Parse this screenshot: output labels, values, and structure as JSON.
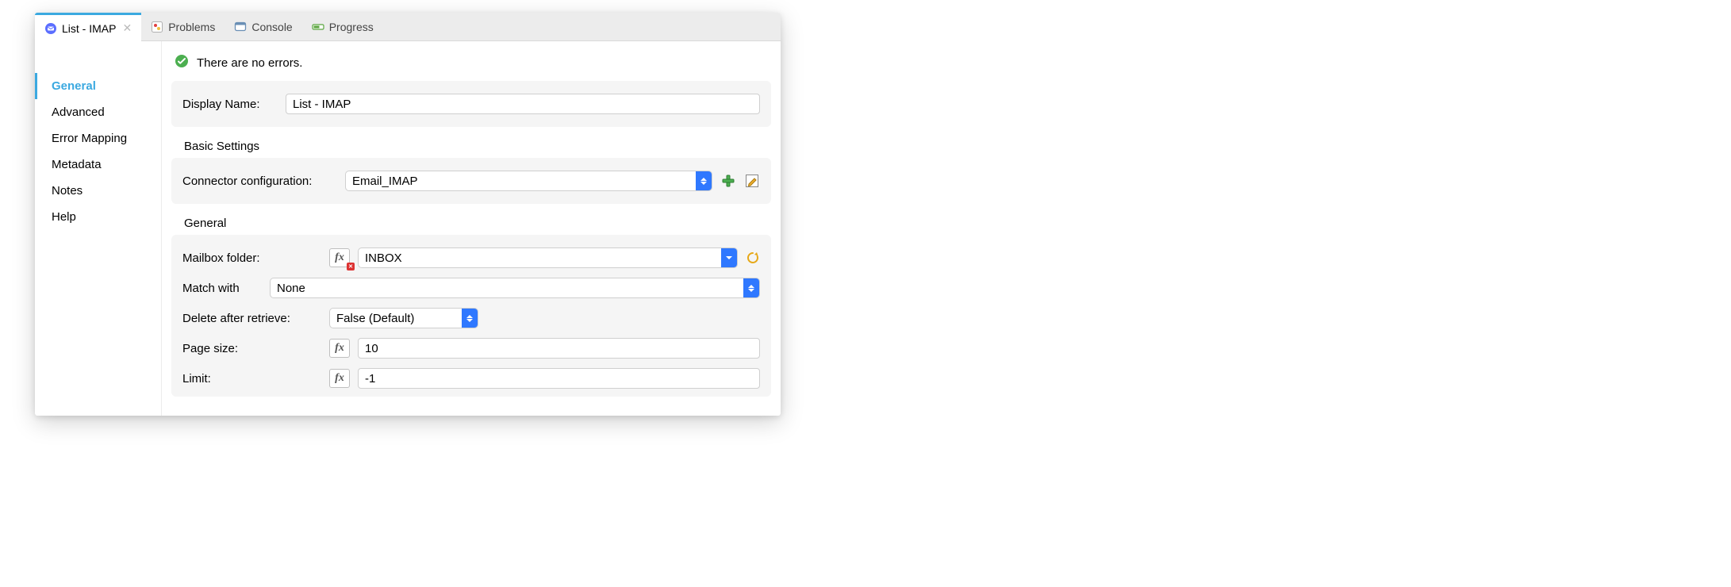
{
  "tabs": [
    {
      "label": "List - IMAP",
      "active": true
    },
    {
      "label": "Problems"
    },
    {
      "label": "Console"
    },
    {
      "label": "Progress"
    }
  ],
  "sidebar": {
    "items": [
      {
        "label": "General",
        "active": true
      },
      {
        "label": "Advanced"
      },
      {
        "label": "Error Mapping"
      },
      {
        "label": "Metadata"
      },
      {
        "label": "Notes"
      },
      {
        "label": "Help"
      }
    ]
  },
  "status": {
    "message": "There are no errors."
  },
  "display_name": {
    "label": "Display Name:",
    "value": "List - IMAP"
  },
  "basic_settings": {
    "title": "Basic Settings",
    "connector_label": "Connector configuration:",
    "connector_value": "Email_IMAP"
  },
  "general": {
    "title": "General",
    "mailbox_label": "Mailbox folder:",
    "mailbox_value": "INBOX",
    "match_label": "Match with",
    "match_value": "None",
    "delete_label": "Delete after retrieve:",
    "delete_value": "False (Default)",
    "page_label": "Page size:",
    "page_value": "10",
    "limit_label": "Limit:",
    "limit_value": "-1"
  }
}
